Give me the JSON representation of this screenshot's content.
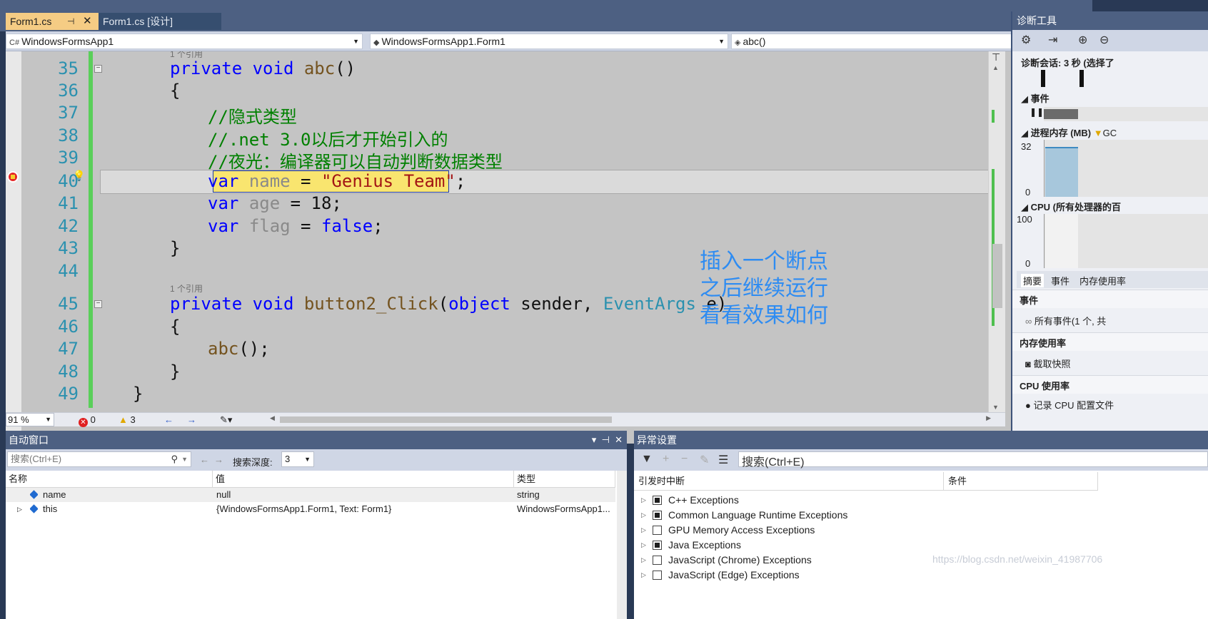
{
  "tabs": [
    {
      "label": "Form1.cs",
      "pin": "⊣",
      "close": "✕"
    },
    {
      "label": "Form1.cs [设计]"
    }
  ],
  "nav": {
    "project": "WindowsFormsApp1",
    "class": "WindowsFormsApp1.Form1",
    "member": "abc()"
  },
  "code": {
    "ref_35": "1 个引用",
    "ref_45": "1 个引用",
    "lines": [
      {
        "n": "35"
      },
      {
        "n": "36"
      },
      {
        "n": "37"
      },
      {
        "n": "38"
      },
      {
        "n": "39"
      },
      {
        "n": "40"
      },
      {
        "n": "41"
      },
      {
        "n": "42"
      },
      {
        "n": "43"
      },
      {
        "n": "44"
      },
      {
        "n": "45"
      },
      {
        "n": "46"
      },
      {
        "n": "47"
      },
      {
        "n": "48"
      },
      {
        "n": "49"
      }
    ],
    "t35_kw": "private void ",
    "t35_fn": "abc",
    "t35_rest": "()",
    "t36": "{",
    "t37": "//隐式类型",
    "t38": "//.net 3.0以后才开始引入的",
    "t39": "//夜光：编译器可以自动判断数据类型",
    "t40_kw": "var",
    "t40_id": "name",
    "t40_op": " = ",
    "t40_str": "\"Genius Team\"",
    "t40_end": ";",
    "t41_kw": "var",
    "t41_id": "age",
    "t41_rest": " = 18;",
    "t42_kw": "var",
    "t42_id": "flag",
    "t42_op": " = ",
    "t42_val": "false",
    "t42_end": ";",
    "t43": "}",
    "t45_kw": "private void ",
    "t45_fn": "button2_Click",
    "t45_p1": "(",
    "t45_kw2": "object",
    "t45_p2": " sender, ",
    "t45_ty": "EventArgs",
    "t45_p3": " e)",
    "t46": "{",
    "t47_fn": "abc",
    "t47_rest": "();",
    "t48": "}",
    "t49": "}"
  },
  "annotation": [
    "插入一个断点",
    "之后继续运行",
    "看看效果如何"
  ],
  "status": {
    "zoom": "91 %",
    "errors": "0",
    "warnings": "3",
    "nav_back": "←",
    "nav_fwd": "→"
  },
  "diagnostics": {
    "title": "诊断工具",
    "session": "诊断会话: 3 秒 (选择了",
    "events_label": "事件",
    "memory_label": "进程内存 (MB)",
    "gc_label": "GC",
    "mem_max": "32",
    "mem_min": "0",
    "cpu_label": "CPU (所有处理器的百",
    "cpu_max": "100",
    "cpu_min": "0",
    "tabs": [
      "摘要",
      "事件",
      "内存使用率"
    ],
    "section_events": "事件",
    "all_events": "所有事件(1 个, 共",
    "section_memory": "内存使用率",
    "snapshot": "截取快照",
    "section_cpu": "CPU 使用率",
    "record_cpu": "记录 CPU 配置文件"
  },
  "autos": {
    "title": "自动窗口",
    "search_placeholder": "搜索(Ctrl+E)",
    "depth_label": "搜索深度:",
    "depth_value": "3",
    "columns": [
      "名称",
      "值",
      "类型"
    ],
    "rows": [
      {
        "expand": "",
        "name": "name",
        "value": "null",
        "type": "string"
      },
      {
        "expand": "▷",
        "name": "this",
        "value": "{WindowsFormsApp1.Form1, Text: Form1}",
        "type": "WindowsFormsApp1..."
      }
    ]
  },
  "exceptions": {
    "title": "异常设置",
    "search_placeholder": "搜索(Ctrl+E)",
    "columns": [
      "引发时中断",
      "条件"
    ],
    "rows": [
      {
        "label": "C++ Exceptions",
        "checked": true
      },
      {
        "label": "Common Language Runtime Exceptions",
        "checked": true
      },
      {
        "label": "GPU Memory Access Exceptions",
        "checked": false
      },
      {
        "label": "Java Exceptions",
        "checked": true
      },
      {
        "label": "JavaScript (Chrome) Exceptions",
        "checked": false
      },
      {
        "label": "JavaScript (Edge) Exceptions",
        "checked": false
      }
    ]
  },
  "watermark": "https://blog.csdn.net/weixin_41987706"
}
